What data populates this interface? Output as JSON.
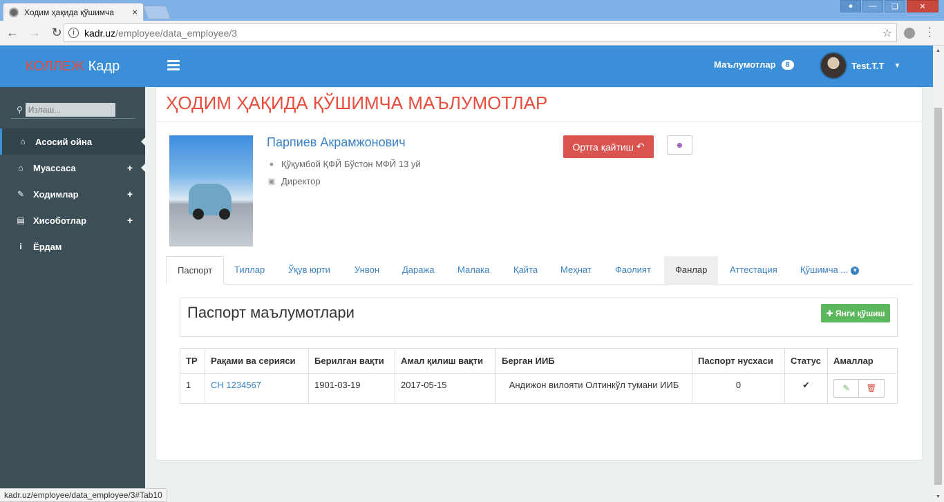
{
  "browser": {
    "tab_title": "Ходим ҳақида қўшимча",
    "tab_close": "×",
    "url_host": "kadr.uz",
    "url_path": "/employee/data_employee/3",
    "status_url": "kadr.uz/employee/data_employee/3#Tab10"
  },
  "brand": {
    "part1": "КОЛЛЕЖ",
    "part2": "Кадр"
  },
  "sidebar": {
    "search_placeholder": "Излаш...",
    "items": [
      {
        "label": "Асосий ойна",
        "icon": "home-icon",
        "plus": ""
      },
      {
        "label": "Муассаса",
        "icon": "home-icon",
        "plus": "+"
      },
      {
        "label": "Ходимлар",
        "icon": "edit-icon",
        "plus": "+"
      },
      {
        "label": "Хисоботлар",
        "icon": "list-icon",
        "plus": "+"
      },
      {
        "label": "Ёрдам",
        "icon": "info-icon",
        "plus": ""
      }
    ]
  },
  "header": {
    "info_label": "Маълумотлар",
    "info_count": "8",
    "user_name": "Test.T.T"
  },
  "page": {
    "title": "ҲОДИМ ҲАҚИДА ҚЎШИМЧА МАЪЛУМОТЛАР",
    "employee_name": "Парпиев Акрамжонович",
    "address": "Қўқумбой ҚФЙ Бўстон МФЙ 13 уй",
    "position": "Директор",
    "back_button": "Ортга қайтиш"
  },
  "tabs": [
    {
      "label": "Паспорт",
      "state": "active"
    },
    {
      "label": "Тиллар",
      "state": ""
    },
    {
      "label": "Ўқув юрти",
      "state": ""
    },
    {
      "label": "Унвон",
      "state": ""
    },
    {
      "label": "Даража",
      "state": ""
    },
    {
      "label": "Малака",
      "state": ""
    },
    {
      "label": "Қайта",
      "state": ""
    },
    {
      "label": "Меҳнат",
      "state": ""
    },
    {
      "label": "Фаолият",
      "state": ""
    },
    {
      "label": "Фанлар",
      "state": "hover"
    },
    {
      "label": "Аттестация",
      "state": ""
    },
    {
      "label": "Қўшимча ...",
      "state": "dropdown"
    }
  ],
  "section": {
    "title": "Паспорт маълумотлари",
    "add_button": "Янги қўшиш"
  },
  "table": {
    "headers": [
      "ТР",
      "Рақами ва серияси",
      "Берилган вақти",
      "Амал қилиш вақти",
      "Берган ИИБ",
      "Паспорт нусхаси",
      "Статус",
      "Амаллар"
    ],
    "rows": [
      {
        "tr": "1",
        "number": "CH 1234567",
        "issued": "1901-03-19",
        "valid": "2017-05-15",
        "issuer": "Андижон вилояти Олтинкўл тумани ИИБ",
        "copy": "0",
        "status": "✔"
      }
    ]
  },
  "colors": {
    "accent": "#3a8fd8",
    "sidebar": "#3c4f57",
    "title_red": "#e74c3c",
    "danger": "#d9534f",
    "success": "#5cb85c"
  }
}
